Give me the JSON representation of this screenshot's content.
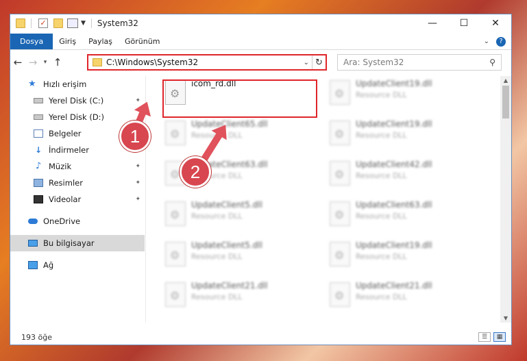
{
  "window": {
    "title": "System32",
    "controls": {
      "minimize": "—",
      "maximize": "☐",
      "close": "✕"
    }
  },
  "ribbon": {
    "tabs": [
      "Dosya",
      "Giriş",
      "Paylaş",
      "Görünüm"
    ],
    "active_tab": "Dosya"
  },
  "address_bar": {
    "path": "C:\\Windows\\System32"
  },
  "search": {
    "placeholder": "Ara: System32"
  },
  "sidebar": {
    "items": [
      {
        "label": "Hızlı erişim",
        "icon": "star-icon"
      },
      {
        "label": "Yerel Disk (C:)",
        "icon": "disk-icon"
      },
      {
        "label": "Yerel Disk (D:)",
        "icon": "disk-icon"
      },
      {
        "label": "Belgeler",
        "icon": "documents-icon"
      },
      {
        "label": "İndirmeler",
        "icon": "download-icon"
      },
      {
        "label": "Müzik",
        "icon": "music-icon"
      },
      {
        "label": "Resimler",
        "icon": "pictures-icon"
      },
      {
        "label": "Videolar",
        "icon": "videos-icon"
      },
      {
        "label": "OneDrive",
        "icon": "cloud-icon"
      },
      {
        "label": "Bu bilgisayar",
        "icon": "computer-icon"
      },
      {
        "label": "Ağ",
        "icon": "network-icon"
      }
    ],
    "selected": "Bu bilgisayar"
  },
  "files": [
    {
      "name": "icom_rd.dll",
      "type": ""
    },
    {
      "name": "UpdateClient19.dll",
      "type": "Resource DLL"
    },
    {
      "name": "UpdateClient65.dll",
      "type": "Resource DLL"
    },
    {
      "name": "UpdateClient19.dll",
      "type": "Resource DLL"
    },
    {
      "name": "UpdateClient63.dll",
      "type": "Resource DLL"
    },
    {
      "name": "UpdateClient42.dll",
      "type": "Resource DLL"
    },
    {
      "name": "UpdateClient5.dll",
      "type": "Resource DLL"
    },
    {
      "name": "UpdateClient63.dll",
      "type": "Resource DLL"
    },
    {
      "name": "UpdateClient5.dll",
      "type": "Resource DLL"
    },
    {
      "name": "UpdateClient19.dll",
      "type": "Resource DLL"
    },
    {
      "name": "UpdateClient21.dll",
      "type": "Resource DLL"
    },
    {
      "name": "UpdateClient21.dll",
      "type": "Resource DLL"
    }
  ],
  "status": {
    "item_count": "193 öğe"
  },
  "annotations": {
    "badge1": "1",
    "badge2": "2",
    "color": "#d8464f"
  }
}
